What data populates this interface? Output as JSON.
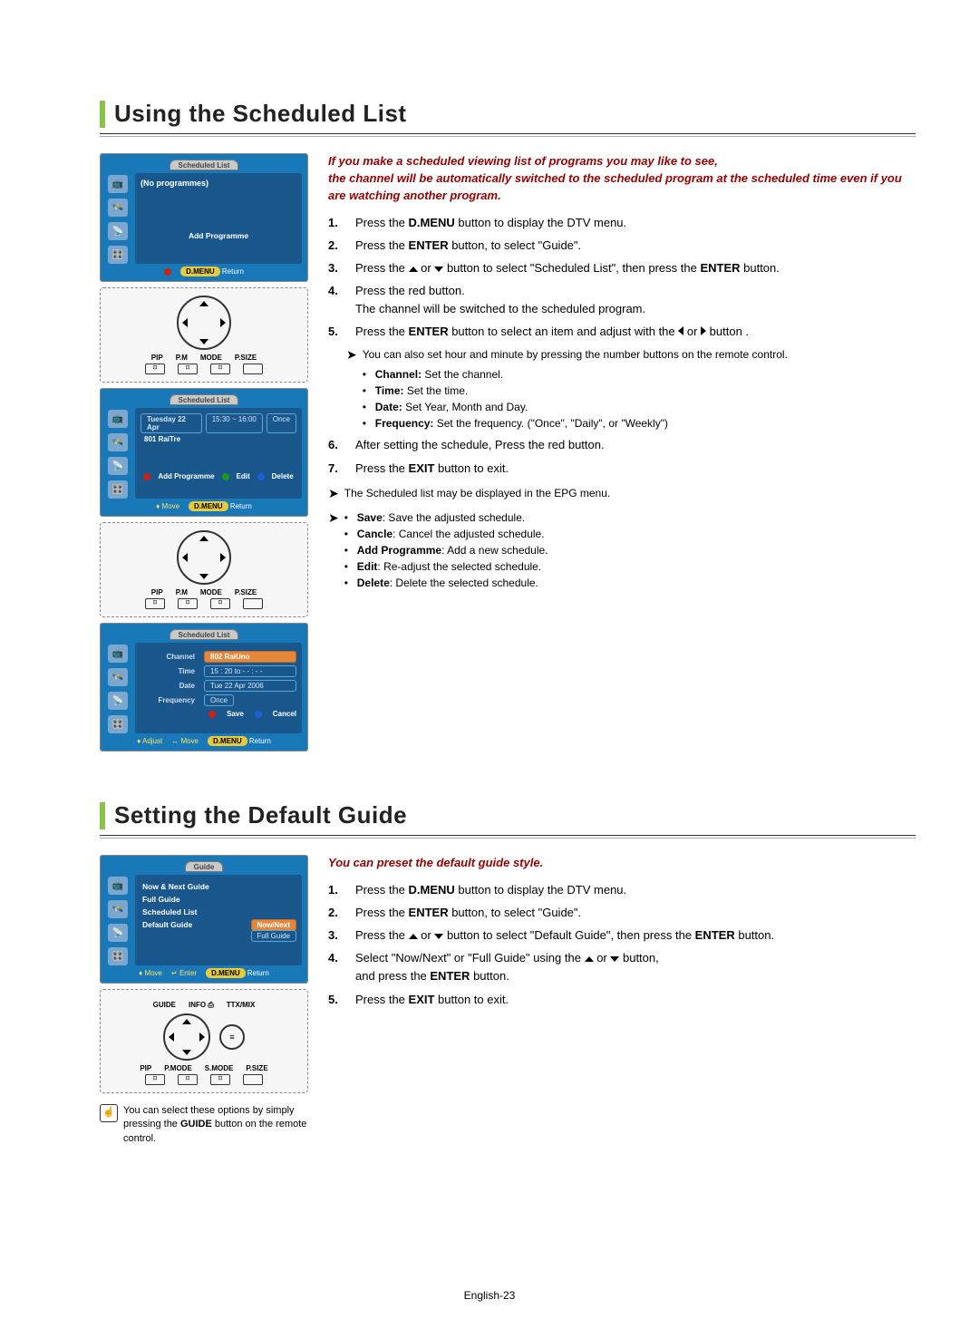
{
  "section1": {
    "heading": "Using the Scheduled List",
    "intro_l1": "If you make a scheduled viewing list of programs you may like to see,",
    "intro_l2": "the channel will be automatically switched to the scheduled program at the scheduled time even if you are watching another program.",
    "steps": {
      "s1a": "Press the ",
      "s1b": "D.MENU",
      "s1c": " button to display the DTV menu.",
      "s2a": "Press the ",
      "s2b": "ENTER",
      "s2c": " button, to select \"Guide\".",
      "s3a": "Press the ",
      "s3b": " or ",
      "s3c": " button to select \"Scheduled List\", then press the ",
      "s3d": "ENTER",
      "s3e": " button.",
      "s4a": "Press the red button.",
      "s4b": "The channel will be switched to the scheduled program.",
      "s5a": "Press the ",
      "s5b": "ENTER",
      "s5c": " button to select an item and adjust with the ",
      "s5d": " or ",
      "s5e": " button .",
      "s5_sub_pre": "You can also set hour and minute by pressing the number buttons on the remote control.",
      "s5_b1a": "Channel:",
      "s5_b1b": " Set the channel.",
      "s5_b2a": "Time:",
      "s5_b2b": " Set the time.",
      "s5_b3a": "Date:",
      "s5_b3b": " Set Year, Month and Day.",
      "s5_b4a": "Frequency:",
      "s5_b4b": " Set the frequency. (\"Once\", \"Daily\", or \"Weekly\")",
      "s6": "After setting the schedule, Press the red button.",
      "s7a": "Press the ",
      "s7b": "EXIT",
      "s7c": " button to exit."
    },
    "notes": {
      "n1": "The Scheduled list may be displayed in the EPG menu.",
      "n2a": "Save",
      "n2b": ": Save the adjusted schedule.",
      "n3a": "Cancle",
      "n3b": ": Cancel the adjusted schedule.",
      "n4a": "Add Programme",
      "n4b": ": Add a new schedule.",
      "n5a": "Edit",
      "n5b": ": Re-adjust the selected schedule.",
      "n6a": "Delete",
      "n6b": ": Delete the selected schedule."
    },
    "tv1": {
      "title": "Scheduled List",
      "noprog": "(No programmes)",
      "add": "Add Programme",
      "dmenu": "D.MENU",
      "ret": "Return"
    },
    "tv2": {
      "title": "Scheduled List",
      "date": "Tuesday 22 Apr",
      "time": "15:30 ~ 16:00",
      "once": "Once",
      "ch": "801  RaiTre",
      "add": "Add Programme",
      "edit": "Edit",
      "del": "Delete",
      "move": "Move",
      "dmenu": "D.MENU",
      "ret": "Return"
    },
    "tv3": {
      "title": "Scheduled List",
      "k_ch": "Channel",
      "v_ch": "802  RaiUno",
      "k_time": "Time",
      "v_time": "15 : 20  to  - - : - -",
      "k_date": "Date",
      "v_date": "Tue  22  Apr  2006",
      "k_freq": "Frequency",
      "v_freq": "Once",
      "save": "Save",
      "cancel": "Cancel",
      "adjust": "Adjust",
      "move": "Move",
      "dmenu": "D.MENU",
      "ret": "Return"
    },
    "remote": {
      "pip": "PIP",
      "pm": "P.M",
      "mode": "MODE",
      "psize": "P.SIZE"
    }
  },
  "section2": {
    "heading": "Setting the Default Guide",
    "intro": "You can preset the default guide style.",
    "steps": {
      "s1a": "Press the ",
      "s1b": "D.MENU",
      "s1c": " button to display the DTV menu.",
      "s2a": "Press the ",
      "s2b": "ENTER",
      "s2c": " button, to select \"Guide\".",
      "s3a": "Press the ",
      "s3b": " or ",
      "s3c": " button to select \"Default Guide\", then press the ",
      "s3d": "ENTER",
      "s3e": " button.",
      "s4a": "Select \"Now/Next\" or \"Full Guide\" using the ",
      "s4b": " or ",
      "s4c": " button,",
      "s4d": "and press the ",
      "s4e": "ENTER",
      "s4f": " button.",
      "s5a": "Press the ",
      "s5b": "EXIT",
      "s5c": " button to exit."
    },
    "tv": {
      "title": "Guide",
      "i1": "Now & Next Guide",
      "i2": "Full Guide",
      "i3": "Scheduled List",
      "i4": "Default Guide",
      "nownext": "Now/Next",
      "full": "Full Guide",
      "move": "Move",
      "enter": "Enter",
      "dmenu": "D.MENU",
      "ret": "Return"
    },
    "remote": {
      "guide": "GUIDE",
      "info": "INFO",
      "ttx": "TTX/MIX",
      "pip": "PIP",
      "pmode": "P.MODE",
      "smode": "S.MODE",
      "psize": "P.SIZE"
    },
    "hint_a": "You can select these options by simply pressing the ",
    "hint_b": "GUIDE",
    "hint_c": " button on the remote control."
  },
  "page_num": "English-23"
}
